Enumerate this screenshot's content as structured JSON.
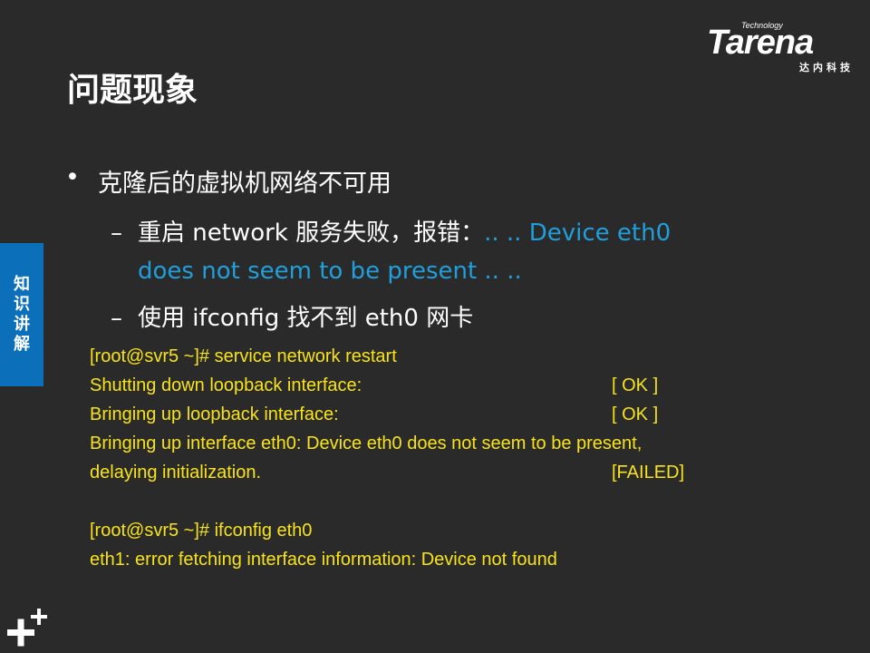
{
  "logo": {
    "brand": "Tarena",
    "tagline": "Technology",
    "cn": "达内科技"
  },
  "title": "问题现象",
  "bullets": {
    "main": "克隆后的虚拟机网络不可用",
    "sub1_prefix": "重启 network 服务失败，报错：",
    "sub1_highlight_a": ".. .. Device eth0",
    "sub1_highlight_b": "does not seem to be present .. ..",
    "sub2": "使用 ifconfig 找不到 eth0 网卡"
  },
  "terminal": {
    "lines": [
      {
        "text": "[root@svr5 ~]# service  network  restart",
        "status": ""
      },
      {
        "text": "Shutting down loopback interface:",
        "status": "[  OK  ]"
      },
      {
        "text": "Bringing up loopback interface:",
        "status": "[  OK  ]"
      },
      {
        "text": "Bringing up interface eth0:  Device eth0 does not seem to be present,",
        "status": ""
      },
      {
        "text": "delaying initialization.",
        "status": "[FAILED]"
      },
      {
        "text": "",
        "status": ""
      },
      {
        "text": "[root@svr5 ~]# ifconfig  eth0",
        "status": ""
      },
      {
        "text": "eth1: error fetching interface information: Device not found",
        "status": ""
      }
    ]
  },
  "sidetab": {
    "chars": [
      "知",
      "识",
      "讲",
      "解"
    ]
  },
  "colors": {
    "background": "#2b2a2a",
    "highlight": "#1f9fdc",
    "terminal_text": "#f7e31b",
    "tab": "#0b6fba"
  },
  "icons": {
    "corner": "plus-plus-icon"
  }
}
